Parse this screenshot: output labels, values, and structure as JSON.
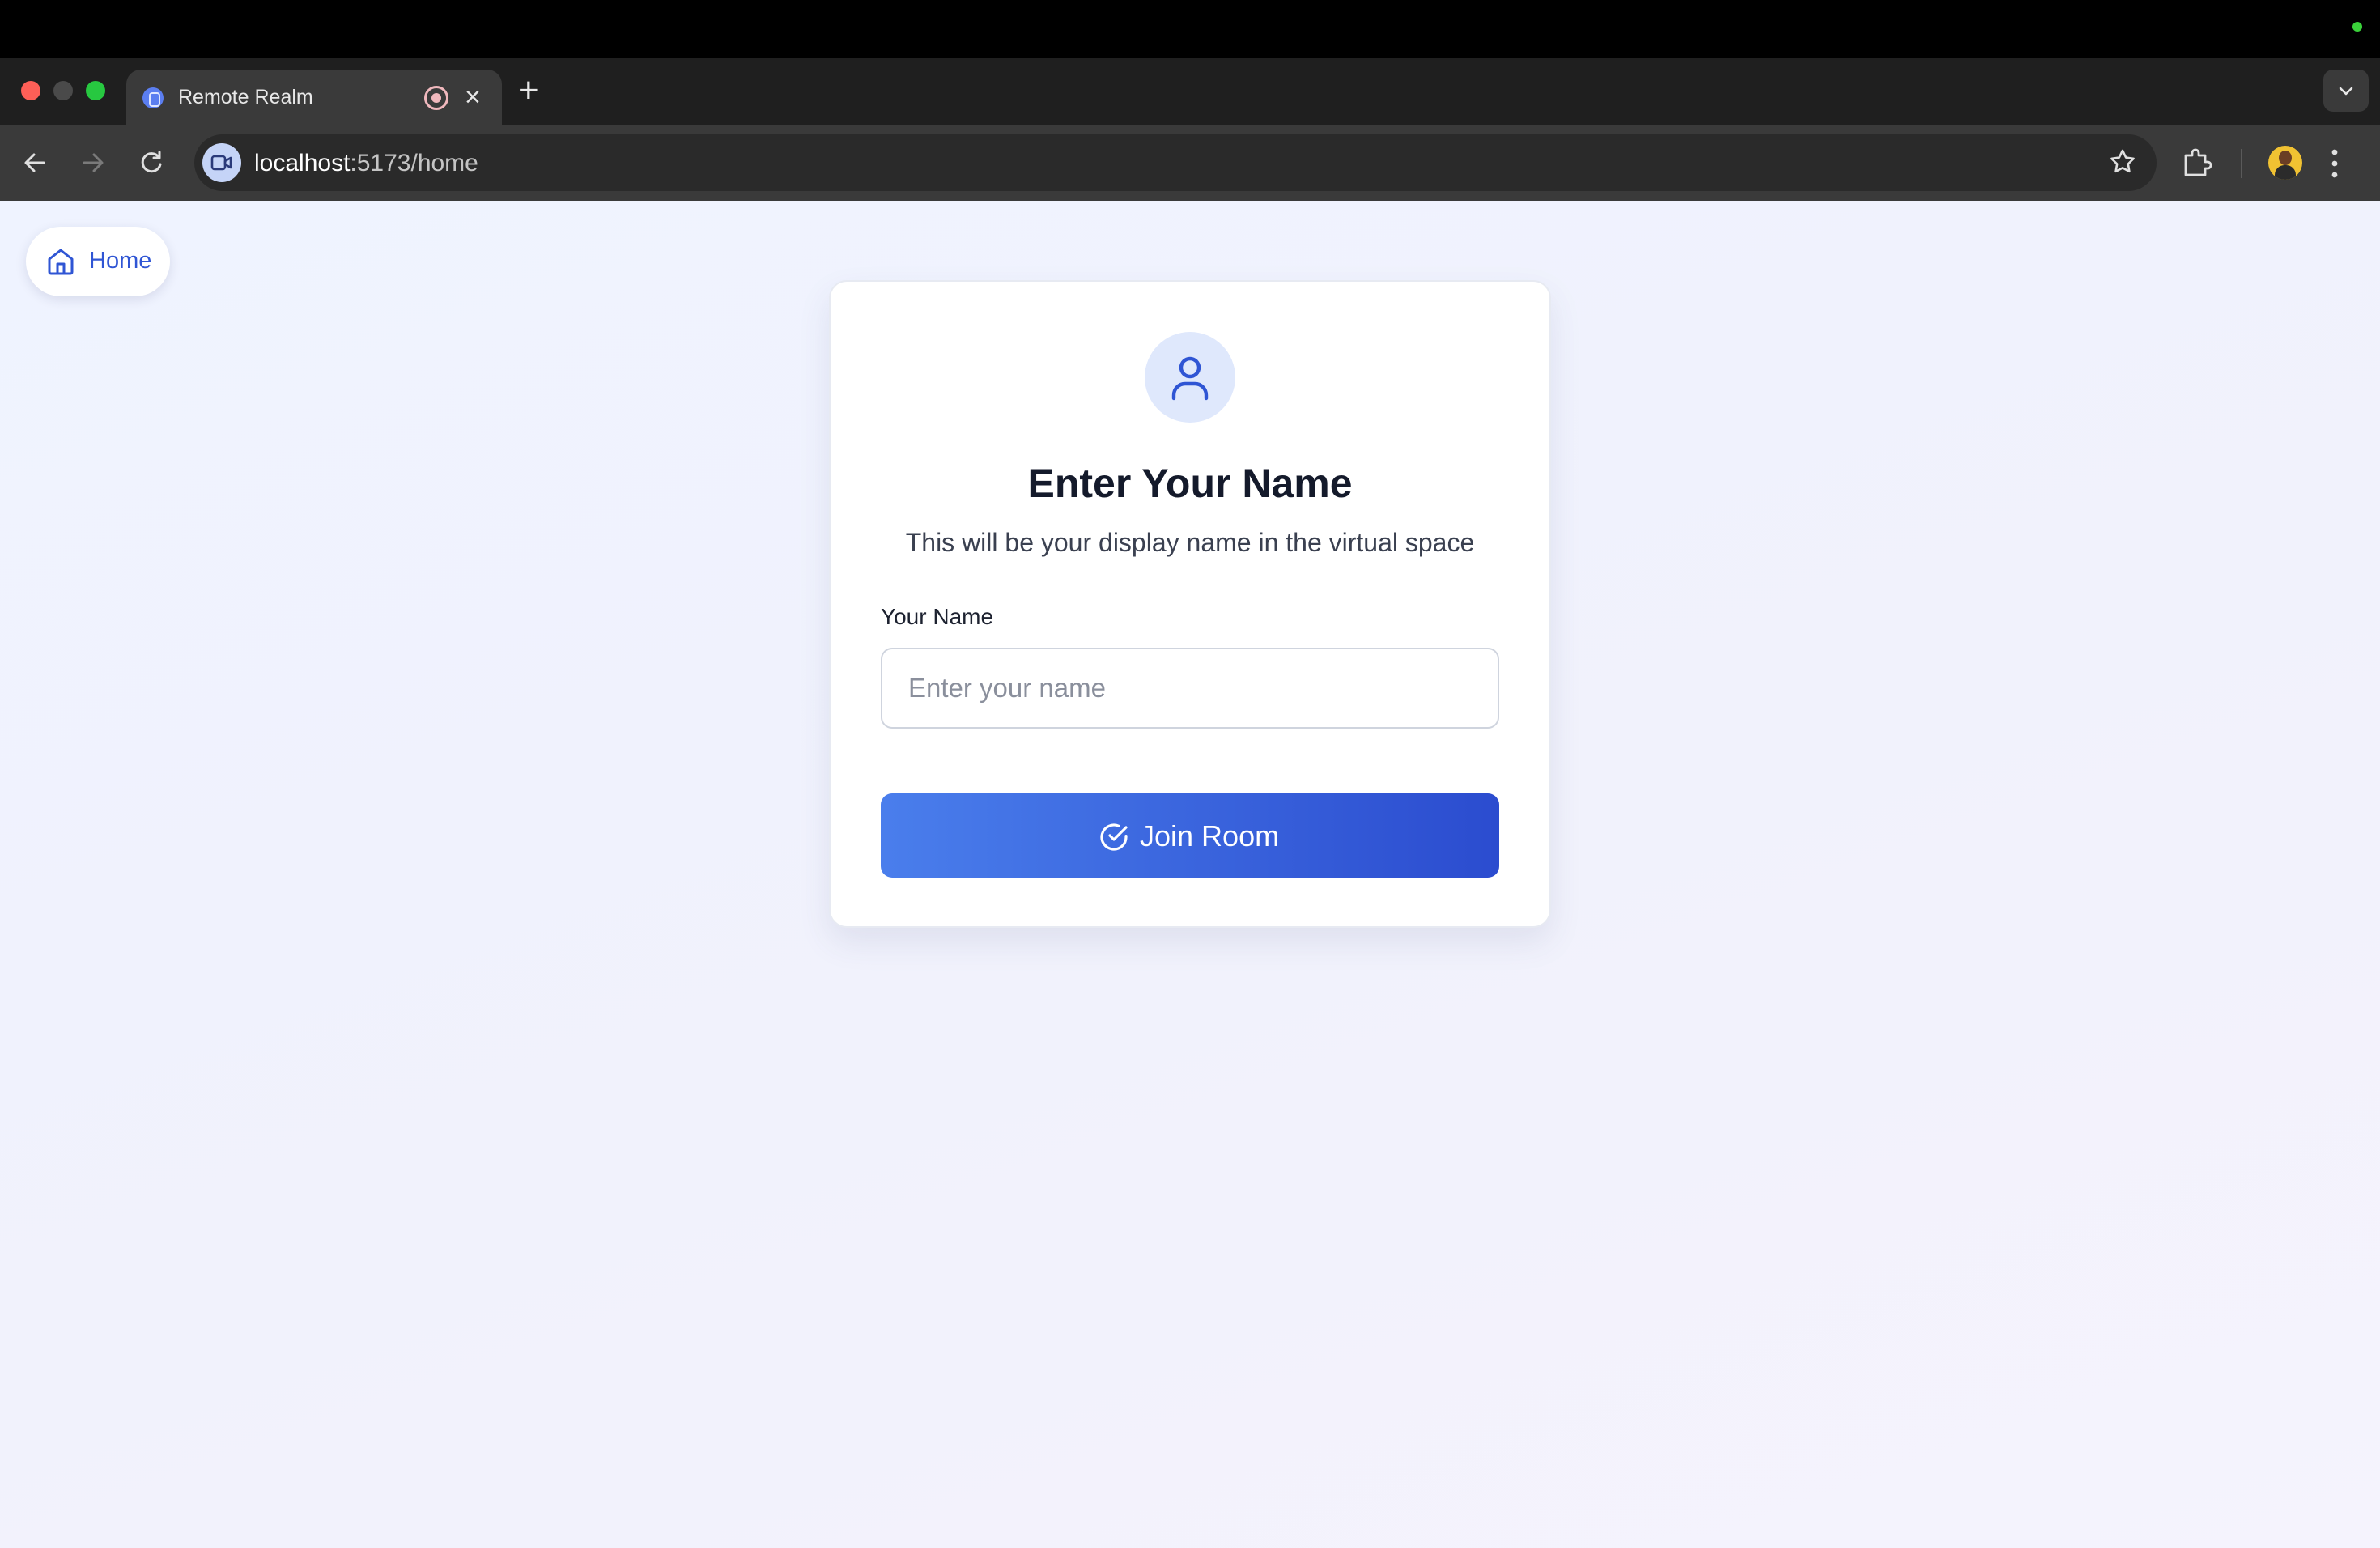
{
  "browser": {
    "tab": {
      "title": "Remote Realm",
      "close_glyph": "×"
    },
    "new_tab_glyph": "+",
    "address": {
      "host": "localhost",
      "port_path": ":5173/home"
    },
    "icons": [
      "back-icon",
      "forward-icon",
      "reload-icon",
      "video-icon",
      "star-icon",
      "extensions-icon",
      "profile-avatar",
      "menu-icon"
    ]
  },
  "page": {
    "home_button": {
      "label": "Home",
      "icon": "home-icon"
    },
    "card": {
      "title": "Enter Your Name",
      "subtitle": "This will be your display name in the virtual space",
      "field_label": "Your Name",
      "input": {
        "value": "",
        "placeholder": "Enter your name"
      },
      "submit_label": "Join Room",
      "submit_icon": "check-circle-icon"
    }
  },
  "colors": {
    "accent": "#2f55d4",
    "button_gradient_start": "#4a7eec",
    "button_gradient_end": "#2b4ccf",
    "page_background": "#eff3ff"
  }
}
